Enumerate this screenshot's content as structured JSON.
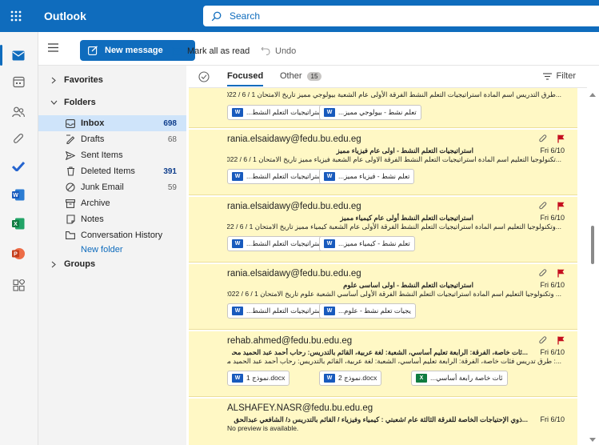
{
  "app": {
    "name": "Outlook"
  },
  "search": {
    "placeholder": "Search"
  },
  "toolbar": {
    "new_message": "New message",
    "mark_all_read": "Mark all as read",
    "undo": "Undo"
  },
  "folders": {
    "favorites": "Favorites",
    "folders_header": "Folders",
    "items": [
      {
        "label": "Inbox",
        "count": "698",
        "icon": "inbox-icon"
      },
      {
        "label": "Drafts",
        "count": "68",
        "icon": "drafts-icon"
      },
      {
        "label": "Sent Items",
        "count": "",
        "icon": "sent-icon"
      },
      {
        "label": "Deleted Items",
        "count": "391",
        "icon": "trash-icon"
      },
      {
        "label": "Junk Email",
        "count": "59",
        "icon": "junk-icon"
      },
      {
        "label": "Archive",
        "count": "",
        "icon": "archive-icon"
      },
      {
        "label": "Notes",
        "count": "",
        "icon": "notes-icon"
      },
      {
        "label": "Conversation History",
        "count": "",
        "icon": "folder-icon"
      }
    ],
    "new_folder": "New folder",
    "groups": "Groups"
  },
  "tabs": {
    "focused": "Focused",
    "other": "Other",
    "other_count": "15",
    "filter": "Filter"
  },
  "messages": [
    {
      "sender": "",
      "subject": "",
      "preview": "...طرق التدريس اسم المادة استراتيجيات التعلم النشط الفرقة الأولى عام الشعبة بيولوجي مميز تاريخ الامتحان 1 / 6 / 2022",
      "date": "",
      "attachments": [
        "...استراتيجيات التعلم النشط",
        "...تعلم نشط - بيولوجي مميز"
      ]
    },
    {
      "sender": "rania.elsaidawy@fedu.bu.edu.eg",
      "subject": "استراتيجيات التعلم النشط - اولى عام فيزياء مميز",
      "preview": "...تكنولوجيا التعليم اسم المادة استراتيجيات التعلم النشط الفرقة الاولى عام الشعبة فيزياء مميز تاريخ الامتحان 1 / 6 / 2022",
      "date": "Fri 6/10",
      "attachments": [
        "...استراتيجيات التعلم النشط",
        "...تعلم نشط - فيزياء مميز"
      ]
    },
    {
      "sender": "rania.elsaidawy@fedu.bu.edu.eg",
      "subject": "استراتيجيات التعلم النشط أولى عام كيمياء مميز",
      "preview": "...وتكنولوجيا التعليم اسم المادة استراتيجيات التعلم النشط الفرقة الأولى عام الشعبة كيمياء مميز تاريخ الامتحان 1 / 6 / 2022",
      "date": "Fri 6/10",
      "attachments": [
        "...استراتيجيات التعلم النشط",
        "...تعلم نشط - كيمياء مميز"
      ]
    },
    {
      "sender": "rania.elsaidawy@fedu.bu.edu.eg",
      "subject": "استراتيجيات التعلم النشط - اولى اساسى علوم",
      "preview": "... وتكنولوجيا التعليم اسم المادة استراتيجيات التعلم النشط الفرقة الأولى أساسي الشعبة علوم تاريخ الامتحان 1 / 6 / 2022",
      "date": "Fri 6/10",
      "attachments": [
        "...استراتيجيات التعلم النشط",
        "...يجيات تعلم نشط - علوم"
      ]
    },
    {
      "sender": "rehab.ahmed@fedu.bu.edu.eg",
      "subject": "...ئات خاصة، الفرقة: الرابعة تعليم أساسي، الشعبة: لغة عربية، القائم بالتدريس: رحاب أحمد عبد الحميد محمد",
      "preview": "...: طرق تدريس فئات خاصة، الفرقة: الرابعة تعليم أساسي، الشعبة: لغة عربية، القائم بالتدريس: رحاب أحمد عبد الحميد محمد",
      "date": "Fri 6/10",
      "attachments": [
        "نموذج 1.docx",
        "نموذج 2.docx",
        "...ئات خاصة رابعة أساسي"
      ]
    },
    {
      "sender": "ALSHAFEY.NASR@fedu.bu.edu.eg",
      "subject": "...ذوي الإحتياجات الخاصة للفرقة الثالثة عام /شعبتي : كيمياء وفيزياء / القائم بالتدريس د/ الشافعي عبدالحق جاد",
      "preview": "No preview is available.",
      "date": "Fri 6/10",
      "attachments": []
    }
  ],
  "colors": {
    "brand": "#0f6cbd",
    "highlight": "#fff8c5",
    "flag": "#c50f1f"
  }
}
